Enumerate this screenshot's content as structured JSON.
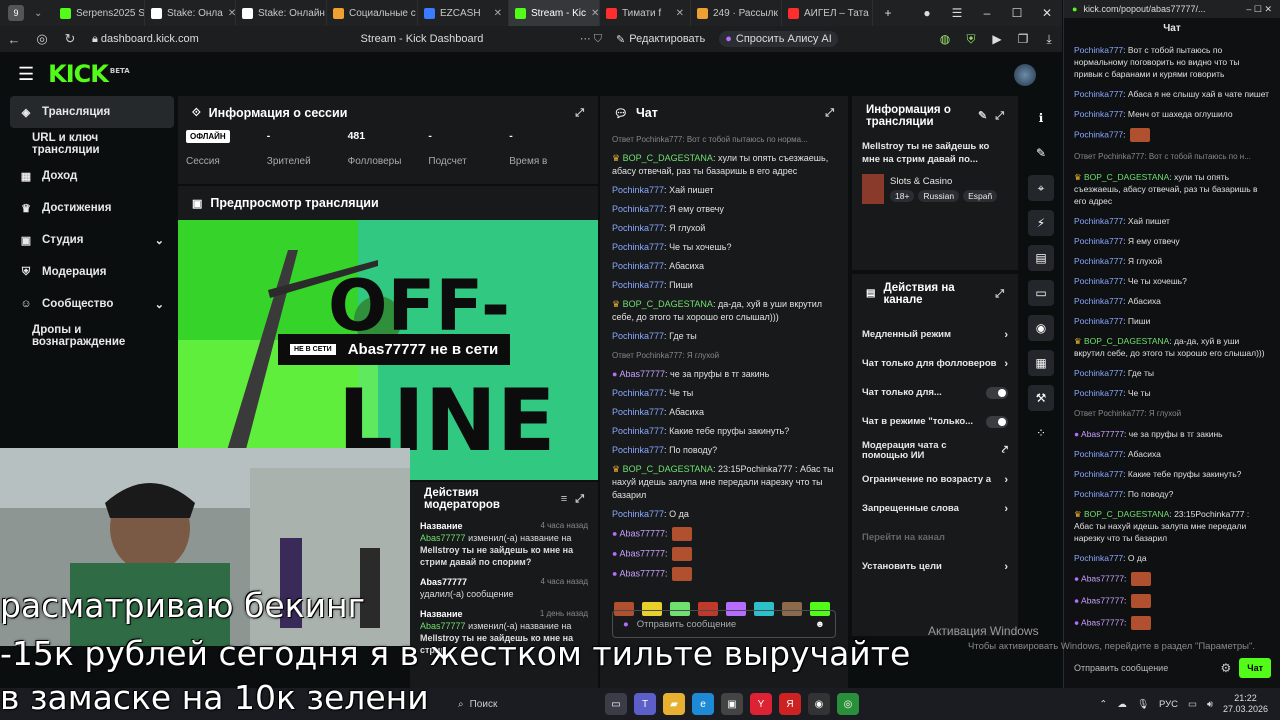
{
  "browser": {
    "tabs": [
      {
        "label": "Serpens2025 S",
        "icon": "kick-icon",
        "color": "#53fc18"
      },
      {
        "label": "Stake: Онла",
        "icon": "stake-icon",
        "color": "#ffffff"
      },
      {
        "label": "Stake: Онлайн",
        "icon": "stake-icon",
        "color": "#ffffff"
      },
      {
        "label": "Социальные с",
        "icon": "mail-icon",
        "color": "#f0a030"
      },
      {
        "label": "EZCASH",
        "icon": "globe-icon",
        "color": "#3a7bff"
      },
      {
        "label": "Stream - Kic",
        "icon": "kick-icon",
        "color": "#53fc18"
      },
      {
        "label": "Тимати f",
        "icon": "youtube-icon",
        "color": "#ff2d2d"
      },
      {
        "label": "249 · Рассылк",
        "icon": "mail-icon",
        "color": "#f0a030"
      },
      {
        "label": "АИГЕЛ – Тата",
        "icon": "youtube-icon",
        "color": "#ff2d2d"
      }
    ],
    "url": "dashboard.kick.com",
    "page_title": "Stream - Kick Dashboard",
    "edit_label": "Редактировать",
    "alice_label": "Спросить Алису AI"
  },
  "sidebar": {
    "items": [
      {
        "label": "Трансляция",
        "icon": "broadcast-icon"
      },
      {
        "label": "URL и ключ трансляции",
        "icon": ""
      },
      {
        "label": "Доход",
        "icon": "income-icon"
      },
      {
        "label": "Достижения",
        "icon": "trophy-icon"
      },
      {
        "label": "Студия",
        "icon": "studio-icon"
      },
      {
        "label": "Модерация",
        "icon": "shield-icon"
      },
      {
        "label": "Сообщество",
        "icon": "community-icon"
      },
      {
        "label": "Дропы и вознаграждение",
        "icon": ""
      }
    ]
  },
  "session": {
    "title": "Информация о сессии",
    "status_badge": "ОФЛАЙН",
    "stats": [
      {
        "value": "",
        "label": "Сессия"
      },
      {
        "value": "-",
        "label": "Зрителей"
      },
      {
        "value": "481",
        "label": "Фолловеры"
      },
      {
        "value": "-",
        "label": "Подсчет"
      },
      {
        "value": "-",
        "label": "Время в"
      }
    ]
  },
  "preview": {
    "title": "Предпросмотр трансляции",
    "offline_badge": "НЕ В СЕТИ",
    "offline_text": "Abas77777 не в сети",
    "big_text_1": "OFF-",
    "big_text_2": "LINE"
  },
  "moderators": {
    "title": "Действия модераторов",
    "entries": [
      {
        "name": "Название",
        "time": "4 часа назад",
        "user": "Abas77777",
        "action": "изменил(-а) название на",
        "detail": "Mellstroy ты не зайдешь ко мне на стрим давай по спорим?"
      },
      {
        "name": "Abas77777",
        "time": "4 часа назад",
        "user": "",
        "action": "удалил(-а) сообщение",
        "detail": ""
      },
      {
        "name": "Название",
        "time": "1 день назад",
        "user": "Abas77777",
        "action": "изменил(-а) название на",
        "detail": "Mellstroy ты не зайдешь ко мне на стрим"
      }
    ]
  },
  "chat": {
    "title": "Чат",
    "messages": [
      {
        "type": "reply",
        "text": "Ответ Pochinka777: Вот с тобой пытаюсь по норма..."
      },
      {
        "user": "BOP_C_DAGESTANA",
        "cls": "u3",
        "text": "хули ты опять съезжаешь, абасу отвечай, раз ты базаришь в его адрес"
      },
      {
        "user": "Pochinka777",
        "cls": "u",
        "text": "Хай пишет"
      },
      {
        "user": "Pochinka777",
        "cls": "u",
        "text": "Я ему отвечу"
      },
      {
        "user": "Pochinka777",
        "cls": "u",
        "text": "Я глухой"
      },
      {
        "user": "Pochinka777",
        "cls": "u",
        "text": "Че ты хочешь?"
      },
      {
        "user": "Pochinka777",
        "cls": "u",
        "text": "Абасиха"
      },
      {
        "user": "Pochinka777",
        "cls": "u",
        "text": "Пиши"
      },
      {
        "user": "BOP_C_DAGESTANA",
        "cls": "u3",
        "text": "да-да, хуй в уши вкрутил себе, до этого ты хорошо его слышал)))"
      },
      {
        "user": "Pochinka777",
        "cls": "u",
        "text": "Где ты"
      },
      {
        "type": "reply",
        "text": "Ответ Pochinka777: Я глухой"
      },
      {
        "user": "Abas77777",
        "cls": "u2",
        "text": "че за пруфы в тг закинь"
      },
      {
        "user": "Pochinka777",
        "cls": "u",
        "text": "Че ты"
      },
      {
        "user": "Pochinka777",
        "cls": "u",
        "text": "Абасиха"
      },
      {
        "user": "Pochinka777",
        "cls": "u",
        "text": "Какие тебе пруфы закинуть?"
      },
      {
        "user": "Pochinka777",
        "cls": "u",
        "text": "По поводу?"
      },
      {
        "user": "BOP_C_DAGESTANA",
        "cls": "u3",
        "text": "23:15Pochinka777 : Абас ты нахуй идешь залупа мне передали нарезку что ты базарил"
      },
      {
        "user": "Pochinka777",
        "cls": "u",
        "text": "О да"
      },
      {
        "user": "Abas77777",
        "cls": "u2",
        "text": ""
      },
      {
        "user": "Abas77777",
        "cls": "u2",
        "text": ""
      },
      {
        "user": "Abas77777",
        "cls": "u2",
        "text": ""
      }
    ],
    "input_placeholder": "Отправить сообщение"
  },
  "stream_info": {
    "title": "Информация о трансляции",
    "stream_title": "Mellstroy ты не зайдешь ко мне на стрим давай по...",
    "category": "Slots & Casino",
    "tags": [
      "18+",
      "Russian",
      "Españ"
    ]
  },
  "channel_actions": {
    "title": "Действия на канале",
    "items": [
      {
        "label": "Медленный режим",
        "control": "arrow"
      },
      {
        "label": "Чат только для фолловеров",
        "control": "arrow"
      },
      {
        "label": "Чат только для...",
        "control": "toggle"
      },
      {
        "label": "Чат в режиме \"только...",
        "control": "toggle"
      },
      {
        "label": "Модерация чата с помощью ИИ",
        "control": "link"
      },
      {
        "label": "Ограничение по возрасту а",
        "control": "arrow"
      },
      {
        "label": "Запрещенные слова",
        "control": "arrow"
      },
      {
        "label": "Перейти на канал",
        "control": "none"
      },
      {
        "label": "Установить цели",
        "control": "arrow"
      }
    ]
  },
  "overlay_text": {
    "line1": "расматриваю бекинг",
    "line2": "-15к рублей сегодня   я в жестком тильте выручайте",
    "line3": "в замаске  на 10к зелени"
  },
  "popout": {
    "url": "kick.com/popout/abas77777/...",
    "title": "Чат",
    "messages": [
      {
        "user": "Pochinka777",
        "cls": "u",
        "text": "Вот с тобой пытаюсь по нормальному поговорить но видно что ты привык с баранами и курями говорить"
      },
      {
        "user": "Pochinka777",
        "cls": "u",
        "text": "Абаса я не слышу хай в чате пишет"
      },
      {
        "user": "Pochinka777",
        "cls": "u",
        "text": "Менч от шахеда оглушило"
      },
      {
        "user": "Pochinka777",
        "cls": "u",
        "text": ""
      },
      {
        "type": "reply",
        "text": "Ответ Pochinka777: Вот с тобой пытаюсь по н..."
      },
      {
        "user": "BOP_C_DAGESTANA",
        "cls": "u3",
        "text": "хули ты опять съезжаешь, абасу отвечай, раз ты базаришь в его адрес"
      },
      {
        "user": "Pochinka777",
        "cls": "u",
        "text": "Хай пишет"
      },
      {
        "user": "Pochinka777",
        "cls": "u",
        "text": "Я ему отвечу"
      },
      {
        "user": "Pochinka777",
        "cls": "u",
        "text": "Я глухой"
      },
      {
        "user": "Pochinka777",
        "cls": "u",
        "text": "Че ты хочешь?"
      },
      {
        "user": "Pochinka777",
        "cls": "u",
        "text": "Абасиха"
      },
      {
        "user": "Pochinka777",
        "cls": "u",
        "text": "Пиши"
      },
      {
        "user": "BOP_C_DAGESTANA",
        "cls": "u3",
        "text": "да-да, хуй в уши вкрутил себе, до этого ты хорошо его слышал)))"
      },
      {
        "user": "Pochinka777",
        "cls": "u",
        "text": "Где ты"
      },
      {
        "user": "Pochinka777",
        "cls": "u",
        "text": "Че ты"
      },
      {
        "type": "reply",
        "text": "Ответ Pochinka777: Я глухой"
      },
      {
        "user": "Abas77777",
        "cls": "u2",
        "text": "че за пруфы в тг закинь"
      },
      {
        "user": "Pochinka777",
        "cls": "u",
        "text": "Абасиха"
      },
      {
        "user": "Pochinka777",
        "cls": "u",
        "text": "Какие тебе пруфы закинуть?"
      },
      {
        "user": "Pochinka777",
        "cls": "u",
        "text": "По поводу?"
      },
      {
        "user": "BOP_C_DAGESTANA",
        "cls": "u3",
        "text": "23:15Pochinka777 : Абас ты нахуй идешь залупа мне передали нарезку что ты базарил"
      },
      {
        "user": "Pochinka777",
        "cls": "u",
        "text": "О да"
      },
      {
        "user": "Abas77777",
        "cls": "u2",
        "text": ""
      },
      {
        "user": "Abas77777",
        "cls": "u2",
        "text": ""
      },
      {
        "user": "Abas77777",
        "cls": "u2",
        "text": ""
      }
    ],
    "input_placeholder": "Отправить сообщение",
    "send_label": "Чат"
  },
  "windows": {
    "activation_title": "Активация Windows",
    "activation_sub": "Чтобы активировать Windows, перейдите в раздел \"Параметры\".",
    "search": "Поиск",
    "lang": "РУС",
    "time": "21:22",
    "date": "27.03.2026"
  },
  "colors": {
    "accent": "#53fc18",
    "panel": "#17191b",
    "bg": "#0b0e0f"
  }
}
